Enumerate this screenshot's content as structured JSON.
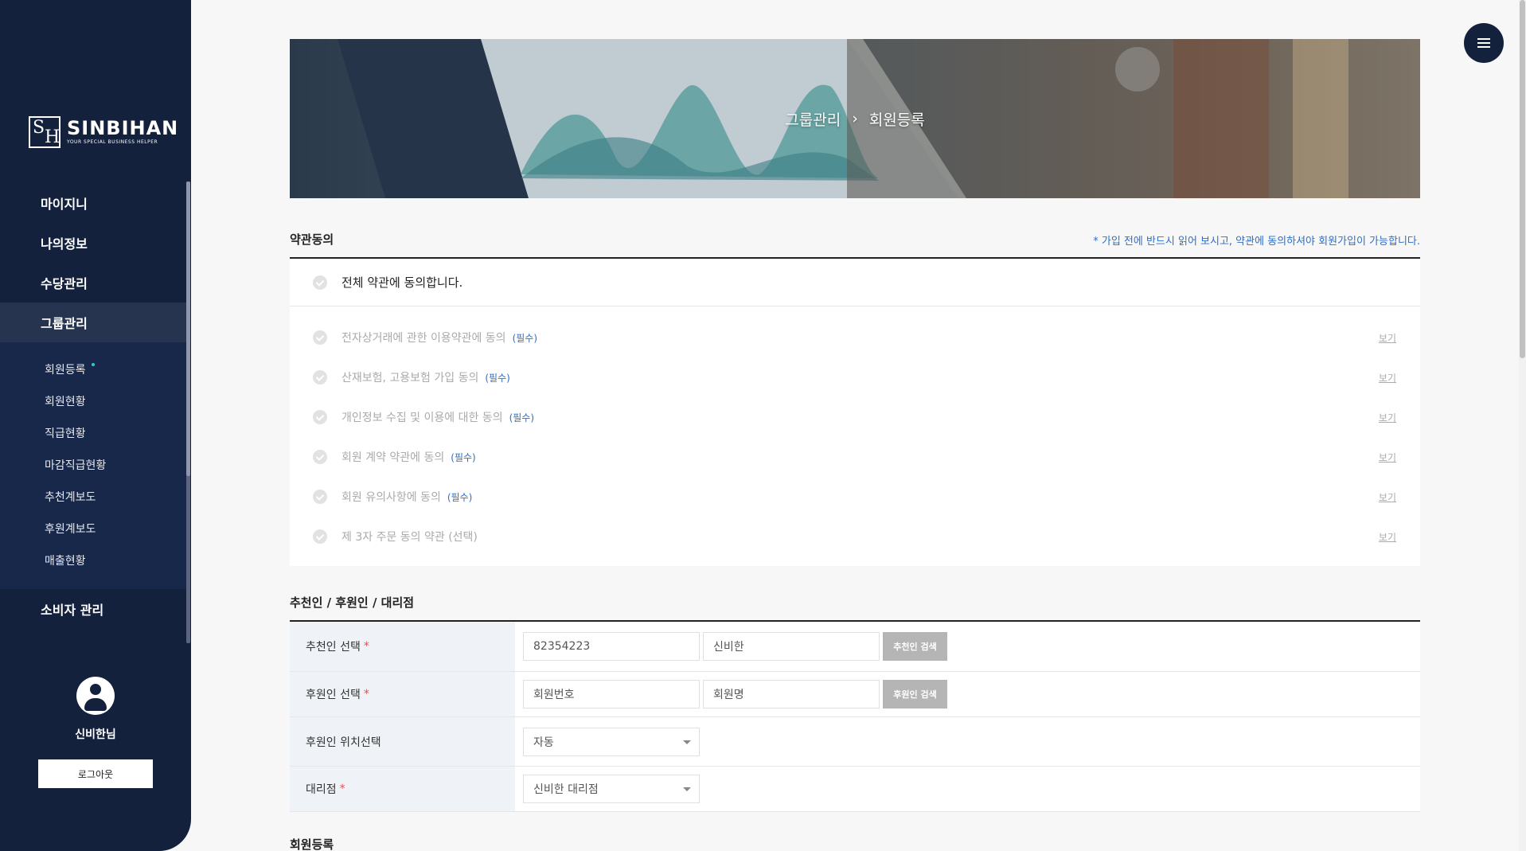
{
  "sidebar": {
    "logo": {
      "name": "SINBIHAN",
      "tagline": "YOUR SPECIAL BUSINESS HELPER"
    },
    "nav": [
      {
        "label": "마이지니"
      },
      {
        "label": "나의정보"
      },
      {
        "label": "수당관리"
      },
      {
        "label": "그룹관리",
        "active": true
      }
    ],
    "subnav": [
      {
        "label": "회원등록",
        "active": true
      },
      {
        "label": "회원현황"
      },
      {
        "label": "직급현황"
      },
      {
        "label": "마감직급현황"
      },
      {
        "label": "추천계보도"
      },
      {
        "label": "후원계보도"
      },
      {
        "label": "매출현황"
      }
    ],
    "nav_bottom": {
      "label": "소비자 관리"
    },
    "user": {
      "name": "신비한님",
      "logout_label": "로그아웃"
    }
  },
  "hero": {
    "breadcrumb_parent": "그룹관리",
    "separator": "›",
    "breadcrumb_current": "회원등록"
  },
  "terms": {
    "section_title": "약관동의",
    "notice": "* 가입 전에 반드시 읽어 보시고, 약관에 동의하셔야 회원가입이 가능합니다.",
    "agree_all": "전체 약관에 동의합니다.",
    "items": [
      {
        "label": "전자상거래에 관한 이용약관에 동의",
        "tag": "(필수)",
        "view": "보기"
      },
      {
        "label": "산재보험, 고용보험 가입 동의",
        "tag": "(필수)",
        "view": "보기"
      },
      {
        "label": "개인정보 수집 및 이용에 대한 동의",
        "tag": "(필수)",
        "view": "보기"
      },
      {
        "label": "회원 계약 약관에 동의",
        "tag": "(필수)",
        "view": "보기"
      },
      {
        "label": "회원 유의사항에 동의",
        "tag": "(필수)",
        "view": "보기"
      },
      {
        "label": "제 3자 주문 동의 약관 (선택)",
        "tag": "",
        "view": "보기"
      }
    ]
  },
  "sponsor": {
    "section_title": "추천인 / 후원인 / 대리점",
    "recommender": {
      "label": "추천인 선택",
      "star": "*",
      "number": "82354223",
      "name": "신비한",
      "button": "추천인 검색"
    },
    "supporter": {
      "label": "후원인 선택",
      "star": "*",
      "number": "회원번호",
      "name": "회원명",
      "button": "후원인 검색"
    },
    "position": {
      "label": "후원인 위치선택",
      "value": "자동"
    },
    "agency": {
      "label": "대리점",
      "star": "*",
      "value": "신비한 대리점"
    }
  },
  "member": {
    "section_title": "회원등록"
  },
  "colors": {
    "sidebar_bg": "#14213d",
    "accent_blue": "#2a6fcf",
    "required_red": "#e05252"
  },
  "icons": {
    "menu": "hamburger-icon",
    "avatar": "user-avatar-icon",
    "check": "check-circle-icon",
    "caret": "caret-down-icon"
  }
}
